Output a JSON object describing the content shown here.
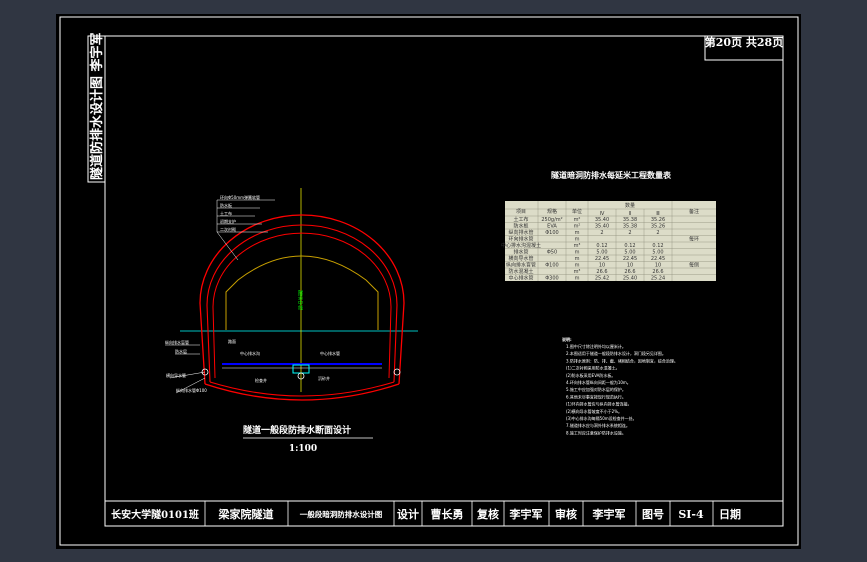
{
  "page": {
    "page_number": "第20页 共28页"
  },
  "side_title": {
    "text": "隧道防排水设计图 李宇军"
  },
  "table": {
    "title": "隧道暗洞防排水每延米工程数量表",
    "header": {
      "item": "项目",
      "spec": "规格",
      "unit": "单位",
      "quantity": "数量",
      "col1": "Ⅳ",
      "col2": "Ⅱ",
      "col3": "Ⅲ",
      "remark": "备注"
    },
    "rows": [
      {
        "item": "土工布",
        "spec": "250g/m²",
        "unit": "m²",
        "c1": "35.40",
        "c2": "35.38",
        "c3": "35.26",
        "remark": ""
      },
      {
        "item": "防水板",
        "spec": "EVA",
        "unit": "m²",
        "c1": "35.40",
        "c2": "35.38",
        "c3": "35.26",
        "remark": ""
      },
      {
        "item": "纵向排水管",
        "spec": "Φ100",
        "unit": "m",
        "c1": "2",
        "c2": "2",
        "c3": "2",
        "remark": ""
      },
      {
        "item": "环向排水管",
        "spec": "",
        "unit": "m",
        "c1": "",
        "c2": "",
        "c3": "",
        "remark": "每环"
      },
      {
        "item": "中心排水沟混凝土",
        "spec": "",
        "unit": "m³",
        "c1": "0.12",
        "c2": "0.12",
        "c3": "0.12",
        "remark": ""
      },
      {
        "item": "排水管",
        "spec": "Φ50",
        "unit": "m",
        "c1": "5.00",
        "c2": "5.00",
        "c3": "5.00",
        "remark": ""
      },
      {
        "item": "横向导水管",
        "spec": "",
        "unit": "m",
        "c1": "22.45",
        "c2": "22.45",
        "c3": "22.45",
        "remark": ""
      },
      {
        "item": "纵向排水盲管",
        "spec": "Φ100",
        "unit": "m",
        "c1": "10",
        "c2": "10",
        "c3": "10",
        "remark": "每侧"
      },
      {
        "item": "防水混凝土",
        "spec": "",
        "unit": "m³",
        "c1": "26.6",
        "c2": "26.6",
        "c3": "26.6",
        "remark": ""
      },
      {
        "item": "中心排水管",
        "spec": "Φ300",
        "unit": "m",
        "c1": "25.42",
        "c2": "25.40",
        "c3": "25.24",
        "remark": ""
      }
    ]
  },
  "drawing": {
    "title": "隧道一般段防排水断面设计",
    "scale": "1:100",
    "leaders_top": [
      "环向Φ50mm弹簧软管",
      "防水板",
      "土工布",
      "初期支护",
      "二次衬砌"
    ],
    "leaders_left": [
      "纵向排水盲管",
      "防水层",
      "横向导水管",
      "纵向排水管Φ100"
    ],
    "leaders_bottom": [
      "路面",
      "中心排水沟",
      "中心排水管",
      "检查井",
      "沉砂井"
    ],
    "centerline": "隧道中线"
  },
  "notes": {
    "heading": "说明:",
    "items": [
      "1.图中尺寸除注明外均以厘米计。",
      "2.本图适用于隧道一般段防排水设计，洞门段另见详图。",
      "3.防排水原则：防、排、截、堵相结合，因地制宜，综合治理。",
      "(1)二次衬砌采用防水混凝土。",
      "(2)防水板采用EVA防水板。",
      "4.环向排水管纵向间距一般为10m。",
      "5.施工中应加强对防水层的保护。",
      "6.其他未尽事宜按现行规范执行。",
      "(1)环向排水管应与纵向排水管连接。",
      "(2)横向导水管坡度不小于2%。",
      "(3)中心排水沟每隔50m设检查井一处。",
      "7.隧道排水应与洞外排水系统相连。",
      "8.施工时应注意保护防排水设施。"
    ]
  },
  "title_block": {
    "school": "长安大学隧0101班",
    "project": "梁家院隧道",
    "drawing_name": "一般段暗洞防排水设计图",
    "design_label": "设计",
    "designer": "曹长勇",
    "review_label": "复核",
    "reviewer": "李宇军",
    "approve_label": "审核",
    "approver": "李宇军",
    "drawing_no_label": "图号",
    "drawing_no": "SI-4",
    "date_label": "日期"
  },
  "colors": {
    "background": "#303642",
    "sheet": "#000000",
    "lines": "#ffffff",
    "lining": "#ff0000",
    "inner_profile": "#c8a000",
    "centerline": "#ffff00",
    "axis": "#00ffff",
    "road": "#0000ff",
    "table_bg": "#dcdcc8"
  }
}
